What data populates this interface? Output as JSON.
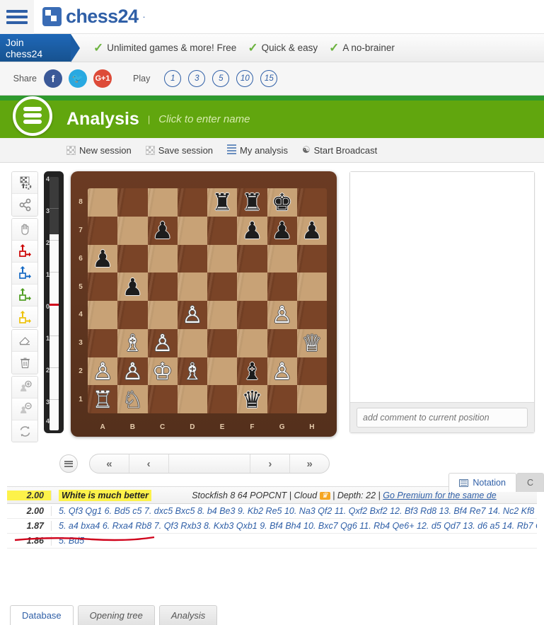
{
  "site": {
    "brand": "chess24",
    "brand_dot": "·",
    "logo_icon": "chess24-knight-logo"
  },
  "promo": {
    "join_label": "Join chess24",
    "benefits": [
      "Unlimited games & more! Free",
      "Quick & easy",
      "A no-brainer"
    ]
  },
  "share": {
    "label": "Share",
    "networks": [
      {
        "name": "facebook",
        "glyph": "f"
      },
      {
        "name": "twitter",
        "glyph": "✉"
      },
      {
        "name": "googleplus",
        "glyph": "G+1"
      }
    ],
    "play_label": "Play",
    "time_controls": [
      "1",
      "3",
      "5",
      "10",
      "15"
    ]
  },
  "session": {
    "title": "Analysis",
    "name_placeholder": "Click to enter name",
    "actions": [
      {
        "label": "New session",
        "icon": "board-grid-icon"
      },
      {
        "label": "Save session",
        "icon": "save-grid-icon"
      },
      {
        "label": "My analysis",
        "icon": "list-icon"
      },
      {
        "label": "Start Broadcast",
        "icon": "broadcast-icon"
      }
    ]
  },
  "tools": [
    {
      "name": "board-setup-icon",
      "title": "Board setup"
    },
    {
      "name": "share-position-icon",
      "title": "Share"
    },
    {
      "name": "hand-move-icon",
      "title": "Move pieces"
    },
    {
      "name": "arrow-red-icon",
      "title": "Red arrow"
    },
    {
      "name": "arrow-blue-icon",
      "title": "Blue arrow"
    },
    {
      "name": "arrow-green-icon",
      "title": "Green arrow"
    },
    {
      "name": "arrow-yellow-icon",
      "title": "Yellow arrow"
    },
    {
      "name": "eraser-icon",
      "title": "Eraser"
    },
    {
      "name": "trash-icon",
      "title": "Delete all"
    },
    {
      "name": "add-piece-icon",
      "title": "Add piece"
    },
    {
      "name": "remove-piece-icon",
      "title": "Remove piece"
    },
    {
      "name": "flip-board-icon",
      "title": "Flip board"
    }
  ],
  "evalbar": {
    "ticks_top": [
      "4",
      "3",
      "2",
      "1",
      "0"
    ],
    "ticks_bottom": [
      "1",
      "2",
      "3",
      "4"
    ],
    "value": 2.0,
    "max": 4.0
  },
  "board": {
    "files": [
      "A",
      "B",
      "C",
      "D",
      "E",
      "F",
      "G",
      "H"
    ],
    "ranks": [
      "8",
      "7",
      "6",
      "5",
      "4",
      "3",
      "2",
      "1"
    ],
    "rows": [
      [
        "",
        "",
        "",
        "",
        "br",
        "br",
        "bk",
        ""
      ],
      [
        "",
        "",
        "bp",
        "",
        "",
        "bp",
        "bp",
        "bp"
      ],
      [
        "bp",
        "",
        "",
        "",
        "",
        "",
        "",
        ""
      ],
      [
        "",
        "bp",
        "",
        "",
        "",
        "",
        "",
        ""
      ],
      [
        "",
        "",
        "",
        "wp",
        "",
        "",
        "wp",
        ""
      ],
      [
        "",
        "wb",
        "wp",
        "",
        "",
        "",
        "",
        "wq"
      ],
      [
        "wp",
        "wp",
        "wk",
        "wb",
        "",
        "bb",
        "wp",
        ""
      ],
      [
        "wr",
        "wn",
        "",
        "",
        "",
        "bq",
        "",
        ""
      ]
    ]
  },
  "notation": {
    "comment_placeholder": "add comment to current position",
    "tabs": [
      {
        "label": "Notation",
        "icon": "notation-icon",
        "active": true
      },
      {
        "label": "C",
        "icon": "chat-icon",
        "active": false
      }
    ]
  },
  "navigation": {
    "menu_icon": "list-menu-icon",
    "buttons": [
      {
        "name": "first-move",
        "glyph": "«"
      },
      {
        "name": "previous-move",
        "glyph": "‹"
      },
      {
        "name": "move-slider",
        "glyph": ""
      },
      {
        "name": "next-move",
        "glyph": "›"
      },
      {
        "name": "last-move",
        "glyph": "»"
      }
    ]
  },
  "engine": {
    "header_score": "2.00",
    "header_verdict": "White is much better",
    "engine_name": "Stockfish 8 64 POPCNT",
    "cloud_label": "Cloud",
    "cloud_badge_icon": "crown-icon",
    "depth_label": "Depth: 22",
    "premium_link": "Go Premium for the same de",
    "separator": "|",
    "lines": [
      {
        "score": "2.00",
        "moves": "5. Qf3 Qg1 6. Bd5 c5 7. dxc5 Bxc5 8. b4 Be3 9. Kb2 Re5 10. Na3 Qf2 11. Qxf2 Bxf2 12. Bf3 Rd8 13. Bf4 Re7 14. Nc2 Kf8"
      },
      {
        "score": "1.87",
        "moves": "5. a4 bxa4 6. Rxa4 Rb8 7. Qf3 Rxb3 8. Kxb3 Qxb1 9. Bf4 Bh4 10. Bxc7 Qg6 11. Rb4 Qe6+ 12. d5 Qd7 13. d6 a5 14. Rb7 Q"
      },
      {
        "score": "1.86",
        "moves": "5. Bd5"
      }
    ]
  },
  "bottom_tabs": [
    {
      "label": "Database",
      "active": true
    },
    {
      "label": "Opening tree",
      "active": false
    },
    {
      "label": "Analysis",
      "active": false
    }
  ],
  "colors": {
    "brand_blue": "#2f5fa7",
    "green_header": "#61a60e",
    "green_line": "#2e9a2e",
    "highlight_yellow": "#fdf24a",
    "annotation_red": "#d0021b"
  }
}
